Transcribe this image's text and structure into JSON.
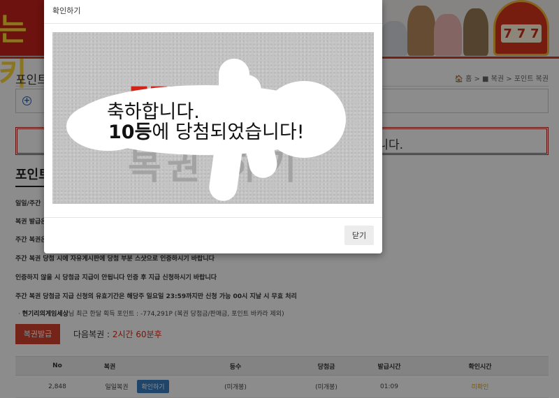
{
  "header": {
    "logo_text": "는키",
    "slot_digits": [
      "7",
      "7",
      "7"
    ]
  },
  "page": {
    "title": "포인트",
    "breadcrumb": "🏠 홈 > ■ 복권 > 포인트 복권"
  },
  "notice": {
    "text": "니다."
  },
  "section_title": "포인트",
  "rules": [
    "일일/주간",
    "복권 발급은",
    "주간 복권은",
    "주간 복권 당첨 시에 자유게시판에 당첨 부분 스샷으로 인증하시기 바랍니다",
    "인증하지 않을 시 당첨금 지급이 안됩니다 인증 후 지급 신청하시기 바랍니다",
    "주간 복권 당첨금 지급 신청의 유효기간은 해당주 일요일 23:59까지만 신청 가능 00시 지날 시 무효 처리"
  ],
  "user_line": {
    "prefix": "·",
    "username": "현기리의게임세상",
    "rest": "님 최근 한달 획득 포인트 : -774,291P (복권 당첨금/판매금, 포인트 바카라 제외)"
  },
  "issue_button": "복권발급",
  "next_lottery": {
    "label": "다음복권 : ",
    "value": "2시간 60분후"
  },
  "table": {
    "headers": [
      "No",
      "복권",
      "등수",
      "당첨금",
      "발급시간",
      "확인시간"
    ],
    "rows": [
      {
        "no": "2,848",
        "type": "일일복권",
        "confirm_btn": "확인하기",
        "rank": "(미개봉)",
        "prize": "(미개봉)",
        "issued": "01:09",
        "checked": "미확인"
      }
    ]
  },
  "modal": {
    "title": "확인하기",
    "scratch_bg_text": "복권 하기",
    "result_line1": "축하합니다.",
    "result_rank": "10등",
    "result_line2_rest": "에 당첨되었습니다!",
    "close_label": "닫기"
  },
  "colors": {
    "accent_red": "#d4422c",
    "blue_button": "#3b7fc4",
    "unconfirmed": "#e0a012"
  }
}
